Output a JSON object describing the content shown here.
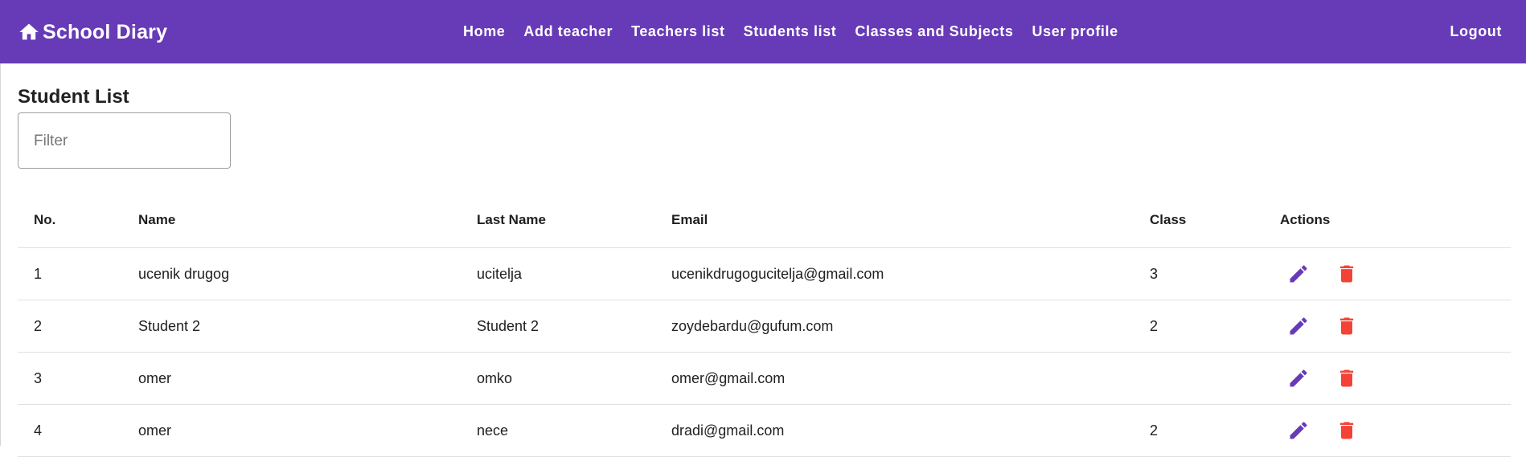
{
  "app": {
    "title": "School Diary",
    "brand_icon": "home-icon"
  },
  "nav": {
    "items": [
      {
        "label": "Home"
      },
      {
        "label": "Add teacher"
      },
      {
        "label": "Teachers list"
      },
      {
        "label": "Students list"
      },
      {
        "label": "Classes and Subjects"
      },
      {
        "label": "User profile"
      }
    ],
    "logout": "Logout"
  },
  "page": {
    "title": "Student List",
    "filter_placeholder": "Filter",
    "filter_value": ""
  },
  "table": {
    "headers": {
      "no": "No.",
      "name": "Name",
      "last_name": "Last Name",
      "email": "Email",
      "class": "Class",
      "actions": "Actions"
    },
    "rows": [
      {
        "no": "1",
        "name": "ucenik drugog",
        "last_name": "ucitelja",
        "email": "ucenikdrugogucitelja@gmail.com",
        "class": "3"
      },
      {
        "no": "2",
        "name": "Student 2",
        "last_name": "Student 2",
        "email": "zoydebardu@gufum.com",
        "class": "2"
      },
      {
        "no": "3",
        "name": "omer",
        "last_name": "omko",
        "email": "omer@gmail.com",
        "class": ""
      },
      {
        "no": "4",
        "name": "omer",
        "last_name": "nece",
        "email": "dradi@gmail.com",
        "class": "2"
      }
    ],
    "action_icons": {
      "edit": "pencil-icon",
      "delete": "trash-icon"
    }
  },
  "colors": {
    "primary": "#673ab7",
    "edit_icon": "#673ab7",
    "delete_icon": "#f44336",
    "toolbar_text": "#ffffff"
  }
}
